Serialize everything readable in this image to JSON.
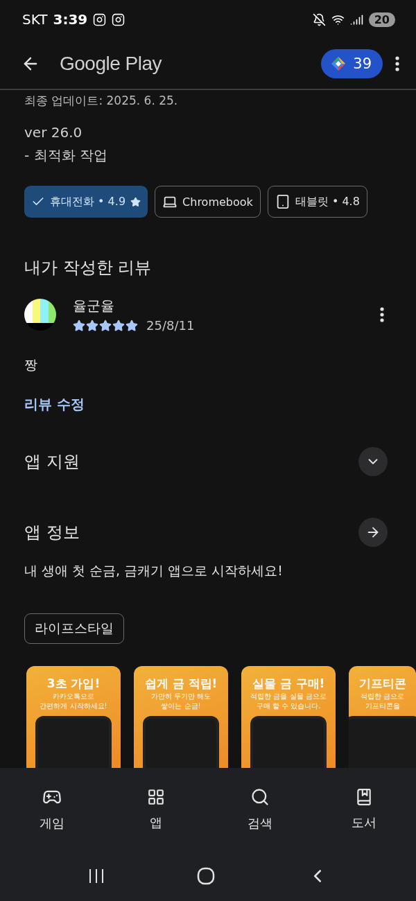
{
  "status_bar": {
    "carrier": "SKT",
    "time": "3:39",
    "battery": "20"
  },
  "app_bar": {
    "title": "Google Play",
    "points": "39"
  },
  "update": {
    "last_updated": "최종 업데이트: 2025. 6. 25.",
    "version": "ver 26.0",
    "notes": "- 최적화 작업"
  },
  "device_chips": [
    {
      "label": "휴대전화 • 4.9",
      "selected": true
    },
    {
      "kind": "laptop",
      "label": "Chromebook",
      "selected": false
    },
    {
      "kind": "tablet",
      "label": "태블릿 • 4.8",
      "selected": false
    }
  ],
  "my_review": {
    "heading": "내가 작성한 리뷰",
    "author": "율군율",
    "stars": 5,
    "date": "25/8/11",
    "text": "짱",
    "edit_link": "리뷰 수정"
  },
  "app_support": {
    "heading": "앱 지원",
    "expanded": false
  },
  "app_info": {
    "heading": "앱 정보",
    "description": "내 생애 첫 순금, 금캐기 앱으로 시작하세요!",
    "tag": "라이프스타일"
  },
  "screenshots": [
    {
      "title": "3초 가입!",
      "subtitle": [
        "카카오톡으로",
        "간편하게 시작하세요!"
      ]
    },
    {
      "title": "쉽게 금 적립!",
      "subtitle": [
        "가만히 두기만 해도",
        "쌓이는 순금!"
      ]
    },
    {
      "title": "실물 금 구매!",
      "subtitle": [
        "적립한 금을 실물 금으로",
        "구매 할 수 있습니다."
      ]
    },
    {
      "title": "기프티콘",
      "subtitle": [
        "적립한 금으로",
        "기프티콘을"
      ]
    }
  ],
  "bottom_nav": [
    {
      "kind": "games",
      "label": "게임",
      "selected": false
    },
    {
      "kind": "apps",
      "label": "앱",
      "selected": false
    },
    {
      "kind": "search",
      "label": "검색",
      "selected": false
    },
    {
      "kind": "books",
      "label": "도서",
      "selected": false
    }
  ]
}
